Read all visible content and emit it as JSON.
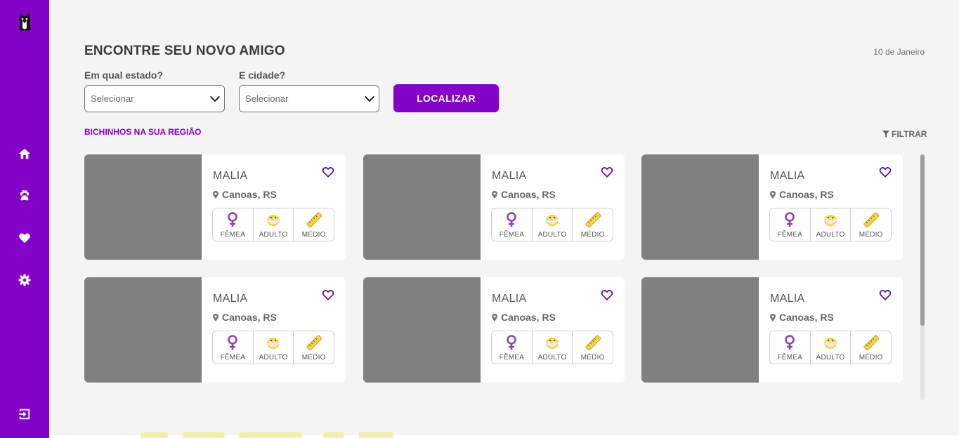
{
  "page": {
    "title": "ENCONTRE SEU NOVO AMIGO",
    "date": "10 de Janeiro"
  },
  "sidebar": {
    "items": [
      {
        "icon": "home-icon"
      },
      {
        "icon": "paw-icon"
      },
      {
        "icon": "heart-icon"
      },
      {
        "icon": "gear-icon"
      }
    ],
    "logout_icon": "logout-icon"
  },
  "filters": {
    "state_label": "Em qual estado?",
    "state_value": "Selecionar",
    "city_label": "E cidade?",
    "city_value": "Selecionar",
    "search_button": "LOCALIZAR"
  },
  "results": {
    "section_title": "BICHINHOS NA SUA REGIÃO",
    "filter_label": "FILTRAR"
  },
  "pets": [
    {
      "name": "MALIA",
      "location": "Canoas, RS",
      "sex": "FÊMEA",
      "age": "ADULTO",
      "size": "MÉDIO"
    },
    {
      "name": "MALIA",
      "location": "Canoas, RS",
      "sex": "FÊMEA",
      "age": "ADULTO",
      "size": "MÉDIO"
    },
    {
      "name": "MALIA",
      "location": "Canoas, RS",
      "sex": "FÊMEA",
      "age": "ADULTO",
      "size": "MÉDIO"
    },
    {
      "name": "MALIA",
      "location": "Canoas, RS",
      "sex": "FÊMEA",
      "age": "ADULTO",
      "size": "MÉDIO"
    },
    {
      "name": "MALIA",
      "location": "Canoas, RS",
      "sex": "FÊMEA",
      "age": "ADULTO",
      "size": "MÉDIO"
    },
    {
      "name": "MALIA",
      "location": "Canoas, RS",
      "sex": "FÊMEA",
      "age": "ADULTO",
      "size": "MÉDIO"
    }
  ],
  "colors": {
    "brand": "#8303c8",
    "card_photo": "#808080",
    "background": "#f4f4f4"
  }
}
